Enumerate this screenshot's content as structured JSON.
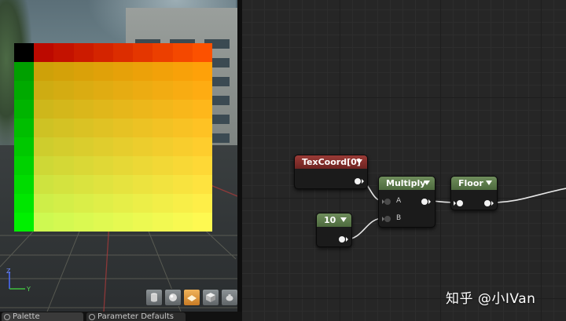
{
  "viewport": {
    "toolbar_icons": [
      "cylinder-icon",
      "sphere-icon",
      "plane-icon",
      "cube-icon",
      "teapot-icon"
    ],
    "active_tool": "plane-icon",
    "axis_labels": {
      "z": "Z",
      "y": "Y"
    }
  },
  "tabs": {
    "palette_label": "Palette",
    "params_label": "Parameter Defaults"
  },
  "nodes": {
    "texcoord": {
      "title": "TexCoord[0]"
    },
    "const": {
      "title": "10"
    },
    "multiply": {
      "title": "Multiply",
      "input_a": "A",
      "input_b": "B"
    },
    "floor": {
      "title": "Floor"
    }
  },
  "watermark": "知乎 @小IVan",
  "colors": {
    "accent_active": "#e49a3a",
    "node_red": "#9a3b37",
    "node_green": "#6f8d5c",
    "wire": "#e6e6e6"
  }
}
